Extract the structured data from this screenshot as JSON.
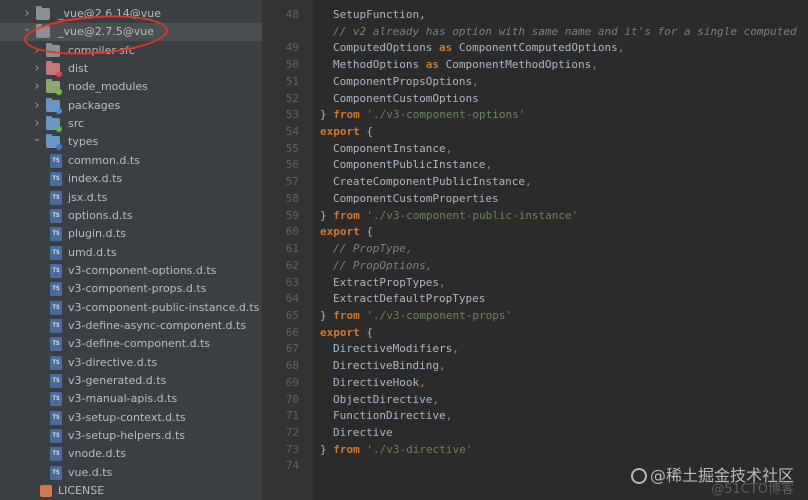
{
  "colors": {
    "sidebar_bg": "#3c3f41",
    "editor_bg": "#2b2b2b",
    "gutter_bg": "#313335",
    "annotation": "#e0352b"
  },
  "tree": [
    {
      "label": "_vue@2.6.14@vue",
      "depth": 0,
      "kind": "folder",
      "expanded": false,
      "icon": "folder-icon"
    },
    {
      "label": "_vue@2.7.5@vue",
      "depth": 0,
      "kind": "folder",
      "expanded": true,
      "selected": true,
      "icon": "folder-icon"
    },
    {
      "label": "compiler-sfc",
      "depth": 1,
      "kind": "folder",
      "expanded": false,
      "icon": "folder-icon"
    },
    {
      "label": "dist",
      "depth": 1,
      "kind": "folder",
      "expanded": false,
      "icon": "folder-dist-icon"
    },
    {
      "label": "node_modules",
      "depth": 1,
      "kind": "folder",
      "expanded": false,
      "icon": "folder-node-modules-icon"
    },
    {
      "label": "packages",
      "depth": 1,
      "kind": "folder",
      "expanded": false,
      "icon": "folder-packages-icon"
    },
    {
      "label": "src",
      "depth": 1,
      "kind": "folder",
      "expanded": false,
      "icon": "folder-src-icon"
    },
    {
      "label": "types",
      "depth": 1,
      "kind": "folder",
      "expanded": true,
      "icon": "folder-types-icon"
    },
    {
      "label": "common.d.ts",
      "depth": 2,
      "kind": "file",
      "icon": "ts-file-icon"
    },
    {
      "label": "index.d.ts",
      "depth": 2,
      "kind": "file",
      "icon": "ts-file-icon"
    },
    {
      "label": "jsx.d.ts",
      "depth": 2,
      "kind": "file",
      "icon": "ts-file-icon"
    },
    {
      "label": "options.d.ts",
      "depth": 2,
      "kind": "file",
      "icon": "ts-file-icon"
    },
    {
      "label": "plugin.d.ts",
      "depth": 2,
      "kind": "file",
      "icon": "ts-file-icon"
    },
    {
      "label": "umd.d.ts",
      "depth": 2,
      "kind": "file",
      "icon": "ts-file-icon"
    },
    {
      "label": "v3-component-options.d.ts",
      "depth": 2,
      "kind": "file",
      "icon": "ts-file-icon"
    },
    {
      "label": "v3-component-props.d.ts",
      "depth": 2,
      "kind": "file",
      "icon": "ts-file-icon"
    },
    {
      "label": "v3-component-public-instance.d.ts",
      "depth": 2,
      "kind": "file",
      "icon": "ts-file-icon"
    },
    {
      "label": "v3-define-async-component.d.ts",
      "depth": 2,
      "kind": "file",
      "icon": "ts-file-icon"
    },
    {
      "label": "v3-define-component.d.ts",
      "depth": 2,
      "kind": "file",
      "icon": "ts-file-icon"
    },
    {
      "label": "v3-directive.d.ts",
      "depth": 2,
      "kind": "file",
      "icon": "ts-file-icon"
    },
    {
      "label": "v3-generated.d.ts",
      "depth": 2,
      "kind": "file",
      "icon": "ts-file-icon"
    },
    {
      "label": "v3-manual-apis.d.ts",
      "depth": 2,
      "kind": "file",
      "icon": "ts-file-icon"
    },
    {
      "label": "v3-setup-context.d.ts",
      "depth": 2,
      "kind": "file",
      "icon": "ts-file-icon"
    },
    {
      "label": "v3-setup-helpers.d.ts",
      "depth": 2,
      "kind": "file",
      "icon": "ts-file-icon"
    },
    {
      "label": "vnode.d.ts",
      "depth": 2,
      "kind": "file",
      "icon": "ts-file-icon"
    },
    {
      "label": "vue.d.ts",
      "depth": 2,
      "kind": "file",
      "icon": "ts-file-icon"
    },
    {
      "label": "LICENSE",
      "depth": 1,
      "kind": "license",
      "icon": "license-file-icon"
    }
  ],
  "editor": {
    "lines": [
      {
        "n": "48",
        "tokens": [
          {
            "t": "SetupFunction,",
            "c": "id"
          }
        ]
      },
      {
        "n": "",
        "tokens": [
          {
            "t": "// v2 already has option with same name and it's for a single computed",
            "c": "comment"
          }
        ]
      },
      {
        "n": "49",
        "tokens": [
          {
            "t": "ComputedOptions ",
            "c": "id"
          },
          {
            "t": "as",
            "c": "kw"
          },
          {
            "t": " ComponentComputedOptions",
            "c": "id"
          },
          {
            "t": ",",
            "c": "punct"
          }
        ]
      },
      {
        "n": "50",
        "tokens": [
          {
            "t": "MethodOptions ",
            "c": "id"
          },
          {
            "t": "as",
            "c": "kw"
          },
          {
            "t": " ComponentMethodOptions",
            "c": "id"
          },
          {
            "t": ",",
            "c": "punct"
          }
        ]
      },
      {
        "n": "51",
        "tokens": [
          {
            "t": "ComponentPropsOptions",
            "c": "id"
          },
          {
            "t": ",",
            "c": "punct"
          }
        ]
      },
      {
        "n": "52",
        "tokens": [
          {
            "t": "ComponentCustomOptions",
            "c": "id"
          }
        ]
      },
      {
        "n": "53",
        "indent": 0,
        "tokens": [
          {
            "t": "} ",
            "c": "id"
          },
          {
            "t": "from",
            "c": "kw"
          },
          {
            "t": " './v3-component-options'",
            "c": "str"
          }
        ]
      },
      {
        "n": "54",
        "indent": 0,
        "tokens": [
          {
            "t": "export",
            "c": "kw"
          },
          {
            "t": " {",
            "c": "id"
          }
        ]
      },
      {
        "n": "55",
        "tokens": [
          {
            "t": "ComponentInstance",
            "c": "id"
          },
          {
            "t": ",",
            "c": "punct"
          }
        ]
      },
      {
        "n": "56",
        "tokens": [
          {
            "t": "ComponentPublicInstance",
            "c": "id"
          },
          {
            "t": ",",
            "c": "punct"
          }
        ]
      },
      {
        "n": "57",
        "tokens": [
          {
            "t": "CreateComponentPublicInstance",
            "c": "id"
          },
          {
            "t": ",",
            "c": "punct"
          }
        ]
      },
      {
        "n": "58",
        "tokens": [
          {
            "t": "ComponentCustomProperties",
            "c": "id"
          }
        ]
      },
      {
        "n": "59",
        "indent": 0,
        "tokens": [
          {
            "t": "} ",
            "c": "id"
          },
          {
            "t": "from",
            "c": "kw"
          },
          {
            "t": " './v3-component-public-instance'",
            "c": "str"
          }
        ]
      },
      {
        "n": "60",
        "indent": 0,
        "tokens": [
          {
            "t": "export",
            "c": "kw"
          },
          {
            "t": " {",
            "c": "id"
          }
        ]
      },
      {
        "n": "61",
        "tokens": [
          {
            "t": "// PropType,",
            "c": "comment"
          }
        ]
      },
      {
        "n": "62",
        "tokens": [
          {
            "t": "// PropOptions,",
            "c": "comment"
          }
        ]
      },
      {
        "n": "63",
        "tokens": [
          {
            "t": "ExtractPropTypes",
            "c": "id"
          },
          {
            "t": ",",
            "c": "punct"
          }
        ]
      },
      {
        "n": "64",
        "tokens": [
          {
            "t": "ExtractDefaultPropTypes",
            "c": "id"
          }
        ]
      },
      {
        "n": "65",
        "indent": 0,
        "tokens": [
          {
            "t": "} ",
            "c": "id"
          },
          {
            "t": "from",
            "c": "kw"
          },
          {
            "t": " './v3-component-props'",
            "c": "str"
          }
        ]
      },
      {
        "n": "66",
        "indent": 0,
        "tokens": [
          {
            "t": "export",
            "c": "kw"
          },
          {
            "t": " {",
            "c": "id"
          }
        ]
      },
      {
        "n": "67",
        "tokens": [
          {
            "t": "DirectiveModifiers",
            "c": "id"
          },
          {
            "t": ",",
            "c": "punct"
          }
        ]
      },
      {
        "n": "68",
        "tokens": [
          {
            "t": "DirectiveBinding",
            "c": "id"
          },
          {
            "t": ",",
            "c": "punct"
          }
        ]
      },
      {
        "n": "69",
        "tokens": [
          {
            "t": "DirectiveHook",
            "c": "id"
          },
          {
            "t": ",",
            "c": "punct"
          }
        ]
      },
      {
        "n": "70",
        "tokens": [
          {
            "t": "ObjectDirective",
            "c": "id"
          },
          {
            "t": ",",
            "c": "punct"
          }
        ]
      },
      {
        "n": "71",
        "tokens": [
          {
            "t": "FunctionDirective",
            "c": "id"
          },
          {
            "t": ",",
            "c": "punct"
          }
        ]
      },
      {
        "n": "72",
        "tokens": [
          {
            "t": "Directive",
            "c": "id"
          }
        ]
      },
      {
        "n": "73",
        "indent": 0,
        "tokens": [
          {
            "t": "} ",
            "c": "id"
          },
          {
            "t": "from",
            "c": "kw"
          },
          {
            "t": " './v3-directive'",
            "c": "str"
          }
        ]
      },
      {
        "n": "74",
        "tokens": []
      }
    ]
  },
  "watermark": {
    "text": "@稀土掘金技术社区",
    "secondary": "@51CTO博客"
  }
}
